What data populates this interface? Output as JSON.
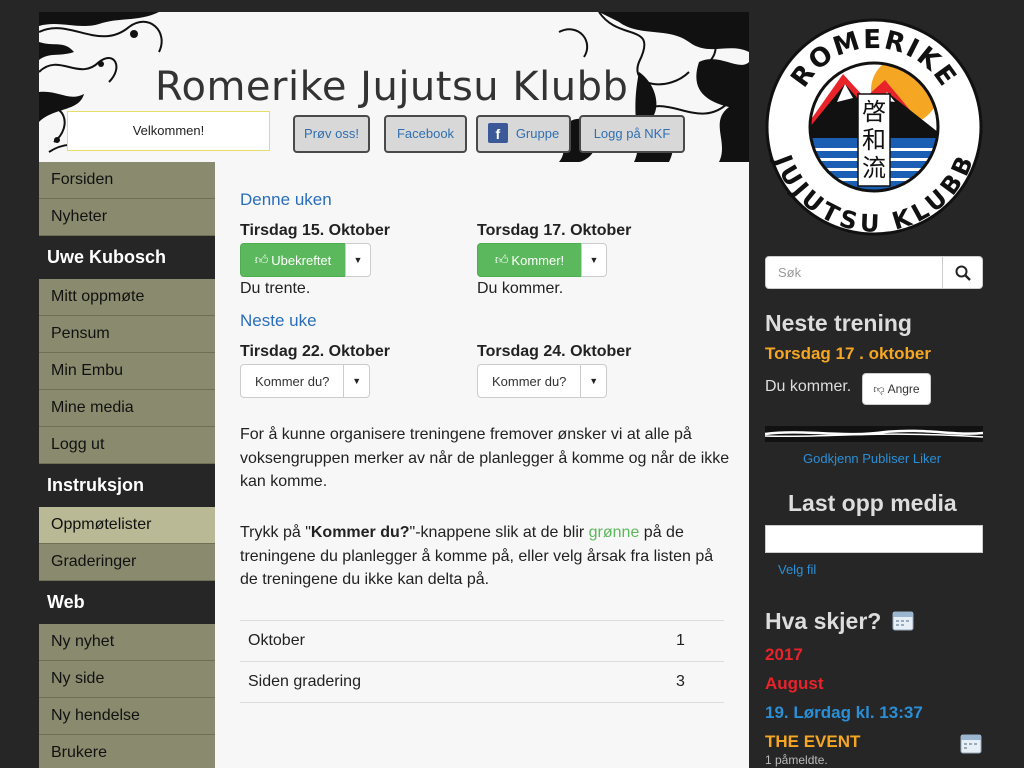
{
  "header": {
    "site_title": "Romerike Jujutsu Klubb",
    "welcome": "Velkommen!",
    "buttons": {
      "try_us": "Prøv oss!",
      "facebook": "Facebook",
      "group": "Gruppe",
      "login_nkf": "Logg på NKF"
    }
  },
  "logo": {
    "top_text": "ROMERIKE",
    "bottom_text": "JUJUTSU KLUBB",
    "kanji": [
      "啓",
      "和",
      "流"
    ]
  },
  "nav": {
    "items_top": [
      "Forsiden",
      "Nyheter"
    ],
    "section_user": "Uwe Kubosch",
    "user_items": [
      "Mitt oppmøte",
      "Pensum",
      "Min Embu",
      "Mine media",
      "Logg ut"
    ],
    "section_instr": "Instruksjon",
    "instr_items": [
      "Oppmøtelister",
      "Graderinger"
    ],
    "section_web": "Web",
    "web_items": [
      "Ny nyhet",
      "Ny side",
      "Ny hendelse",
      "Brukere"
    ]
  },
  "main": {
    "this_week": "Denne uken",
    "next_week": "Neste uke",
    "sessions": [
      {
        "title": "Tirsdag 15. Oktober",
        "button": "Ubekreftet",
        "status": "Du trente."
      },
      {
        "title": "Torsdag 17. Oktober",
        "button": "Kommer!",
        "status": "Du kommer."
      },
      {
        "title": "Tirsdag 22. Oktober",
        "button": "Kommer du?"
      },
      {
        "title": "Torsdag 24. Oktober",
        "button": "Kommer du?"
      }
    ],
    "para1": "For å kunne organisere treningene fremover ønsker vi at alle på voksengruppen merker av når de planlegger å komme og når de ikke kan komme.",
    "para2_a": "Trykk på \"",
    "para2_bold": "Kommer du?",
    "para2_b": "\"-knappene slik at de blir ",
    "para2_green": "grønne",
    "para2_c": " på de treningene du planlegger å komme på, eller velg årsak fra listen på de treningene du ikke kan delta på.",
    "table": [
      {
        "label": "Oktober",
        "value": "1"
      },
      {
        "label": "Siden gradering",
        "value": "3"
      }
    ]
  },
  "sidebar": {
    "search_placeholder": "Søk",
    "next_training_heading": "Neste trening",
    "next_training_date": "Torsdag 17 . oktober",
    "you_coming": "Du kommer.",
    "undo_button": "Angre",
    "media_links": "Godkjenn Publiser Liker",
    "upload_heading": "Last opp media",
    "choose_file": "Velg fil",
    "events_heading": "Hva skjer?",
    "year": "2017",
    "month": "August",
    "event_date": "19. Lørdag kl. 13:37",
    "event_title": "THE EVENT",
    "event_attendees": "1 påmeldte."
  },
  "colors": {
    "accent_blue": "#2a6ebb",
    "success_green": "#5cb85c",
    "nav_olive": "#8a8a6e",
    "orange": "#f5a623",
    "red": "#e8232a"
  }
}
